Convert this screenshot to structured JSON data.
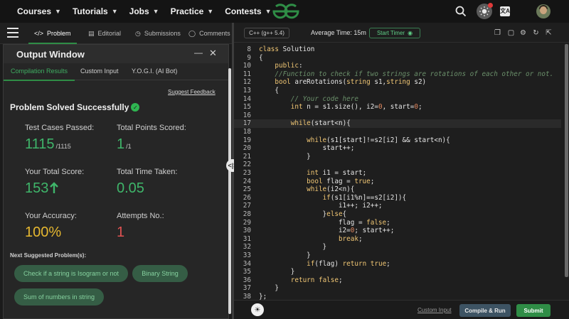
{
  "nav": {
    "items": [
      {
        "label": "Courses"
      },
      {
        "label": "Tutorials"
      },
      {
        "label": "Jobs"
      },
      {
        "label": "Practice"
      },
      {
        "label": "Contests"
      }
    ],
    "logo_text": "GfG",
    "translate_icon_text": "文A"
  },
  "problem_tabs": [
    {
      "label": "Problem",
      "icon": "code-icon",
      "active": true
    },
    {
      "label": "Editorial",
      "icon": "document-icon"
    },
    {
      "label": "Submissions",
      "icon": "clock-icon"
    },
    {
      "label": "Comments",
      "icon": "chat-icon"
    }
  ],
  "output_window": {
    "title": "Output Window",
    "tabs": [
      {
        "label": "Compilation Results",
        "active": true
      },
      {
        "label": "Custom Input"
      },
      {
        "label": "Y.O.G.I. (AI Bot)"
      }
    ],
    "suggest_feedback": "Suggest Feedback",
    "status": "Problem Solved Successfully",
    "stats": {
      "test_cases_label": "Test Cases Passed:",
      "test_cases_value": "1115",
      "test_cases_total": "/1115",
      "points_label": "Total Points Scored:",
      "points_value": "1",
      "points_total": "/1",
      "score_label": "Your Total Score:",
      "score_value": "153",
      "time_label": "Total Time Taken:",
      "time_value": "0.05",
      "accuracy_label": "Your Accuracy:",
      "accuracy_value": "100%",
      "attempts_label": "Attempts No.:",
      "attempts_value": "1"
    },
    "next_label": "Next Suggested Problem(s):",
    "suggestions": [
      {
        "label": "Check if a string is Isogram or not"
      },
      {
        "label": "Binary String"
      },
      {
        "label": "Sum of numbers in string"
      }
    ]
  },
  "editor_toolbar": {
    "language": "C++ (g++ 5.4)",
    "average_time": "Average Time: 15m",
    "start_timer": "Start Timer"
  },
  "code": {
    "lines": [
      {
        "n": "8",
        "text": "class Solution"
      },
      {
        "n": "9",
        "text": "{"
      },
      {
        "n": "10",
        "text": "    public:"
      },
      {
        "n": "11",
        "text": "    //Function to check if two strings are rotations of each other or not."
      },
      {
        "n": "12",
        "text": "    bool areRotations(string s1,string s2)"
      },
      {
        "n": "13",
        "text": "    {"
      },
      {
        "n": "14",
        "text": "        // Your code here"
      },
      {
        "n": "15",
        "text": "        int n = s1.size(), i2=0, start=0;"
      },
      {
        "n": "16",
        "text": ""
      },
      {
        "n": "17",
        "text": "        while(start<n){"
      },
      {
        "n": "18",
        "text": ""
      },
      {
        "n": "19",
        "text": "            while(s1[start]!=s2[i2] && start<n){"
      },
      {
        "n": "20",
        "text": "                start++;"
      },
      {
        "n": "21",
        "text": "            }"
      },
      {
        "n": "22",
        "text": ""
      },
      {
        "n": "23",
        "text": "            int i1 = start;"
      },
      {
        "n": "24",
        "text": "            bool flag = true;"
      },
      {
        "n": "25",
        "text": "            while(i2<n){"
      },
      {
        "n": "26",
        "text": "                if(s1[i1%n]==s2[i2]){"
      },
      {
        "n": "27",
        "text": "                    i1++; i2++;"
      },
      {
        "n": "28",
        "text": "                }else{"
      },
      {
        "n": "29",
        "text": "                    flag = false;"
      },
      {
        "n": "30",
        "text": "                    i2=0; start++;"
      },
      {
        "n": "31",
        "text": "                    break;"
      },
      {
        "n": "32",
        "text": "                }"
      },
      {
        "n": "33",
        "text": "            }"
      },
      {
        "n": "34",
        "text": "            if(flag) return true;"
      },
      {
        "n": "35",
        "text": "        }"
      },
      {
        "n": "36",
        "text": "        return false;"
      },
      {
        "n": "37",
        "text": "    }"
      },
      {
        "n": "38",
        "text": "};"
      }
    ],
    "current_line": "17"
  },
  "bottom": {
    "custom_input": "Custom Input",
    "compile_run": "Compile & Run",
    "submit": "Submit"
  },
  "colors": {
    "brand_green": "#2f8d46",
    "stat_green": "#3fb56a",
    "accuracy_yellow": "#e6b830",
    "attempts_red": "#e05252",
    "keyword": "#f0c674",
    "comment": "#6a8f6a"
  }
}
